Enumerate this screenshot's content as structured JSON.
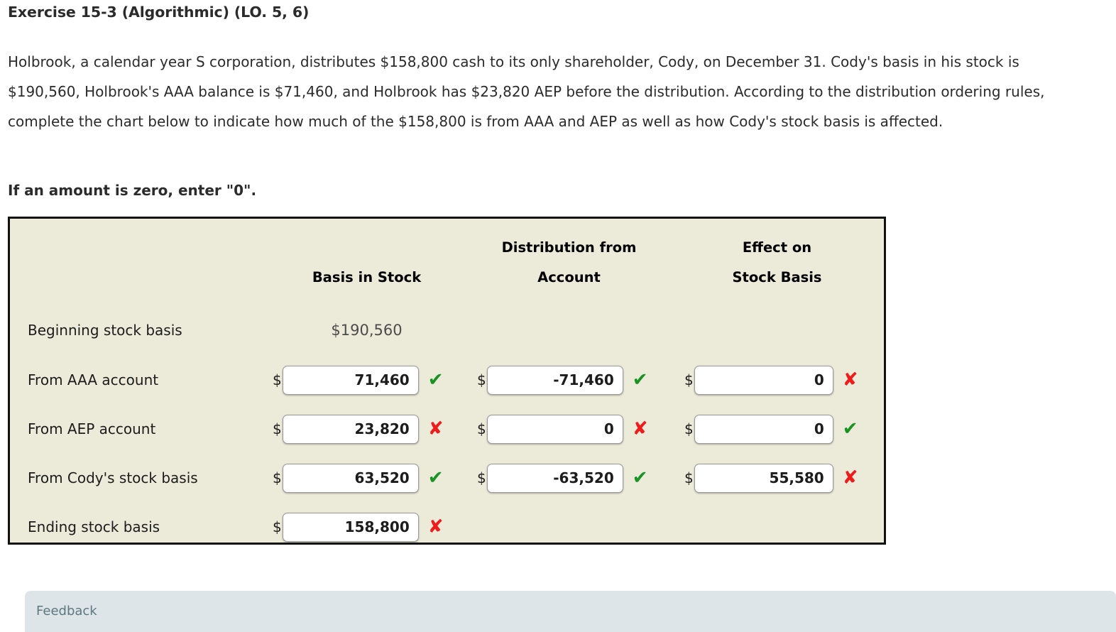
{
  "exercise": {
    "title": "Exercise 15-3 (Algorithmic) (LO. 5, 6)",
    "problem_text": "Holbrook, a calendar year S corporation, distributes $158,800 cash to its only shareholder, Cody, on December 31. Cody's basis in his stock is $190,560, Holbrook's AAA balance is $71,460, and Holbrook has $23,820 AEP before the distribution. According to the distribution ordering rules, complete the chart below to indicate how much of the $158,800 is from AAA and AEP as well as how Cody's stock basis is affected.",
    "zero_note": "If an amount is zero, enter \"0\"."
  },
  "table": {
    "headers": {
      "label_col": "",
      "basis_in_stock": "Basis in Stock",
      "distribution_from_line1": "Distribution from",
      "distribution_from_line2": "Account",
      "effect_on_line1": "Effect on",
      "effect_on_line2": "Stock Basis"
    },
    "currency_symbol": "$",
    "rows": [
      {
        "label": "Beginning stock basis",
        "type": "static",
        "basis_in_stock": "$190,560"
      },
      {
        "label": "From AAA account",
        "type": "inputs",
        "basis_in_stock": {
          "value": "71,460",
          "mark": "check"
        },
        "distribution_from_account": {
          "value": "-71,460",
          "mark": "check"
        },
        "effect_on_stock_basis": {
          "value": "0",
          "mark": "cross"
        }
      },
      {
        "label": "From AEP account",
        "type": "inputs",
        "basis_in_stock": {
          "value": "23,820",
          "mark": "cross"
        },
        "distribution_from_account": {
          "value": "0",
          "mark": "cross"
        },
        "effect_on_stock_basis": {
          "value": "0",
          "mark": "check"
        }
      },
      {
        "label": "From Cody's stock basis",
        "type": "inputs",
        "basis_in_stock": {
          "value": "63,520",
          "mark": "check"
        },
        "distribution_from_account": {
          "value": "-63,520",
          "mark": "check"
        },
        "effect_on_stock_basis": {
          "value": "55,580",
          "mark": "cross"
        }
      },
      {
        "label": "Ending stock basis",
        "type": "inputs",
        "basis_in_stock": {
          "value": "158,800",
          "mark": "cross"
        }
      }
    ]
  },
  "marks": {
    "check_glyph": "✔",
    "cross_glyph": "✘",
    "check_color": "#1a9322",
    "cross_color": "#ef1b1b"
  },
  "feedback": {
    "label": "Feedback"
  },
  "colors": {
    "panel_background": "#ecead9",
    "panel_border": "#111111",
    "feedback_background": "#dee5e8",
    "feedback_text": "#5d7880"
  }
}
